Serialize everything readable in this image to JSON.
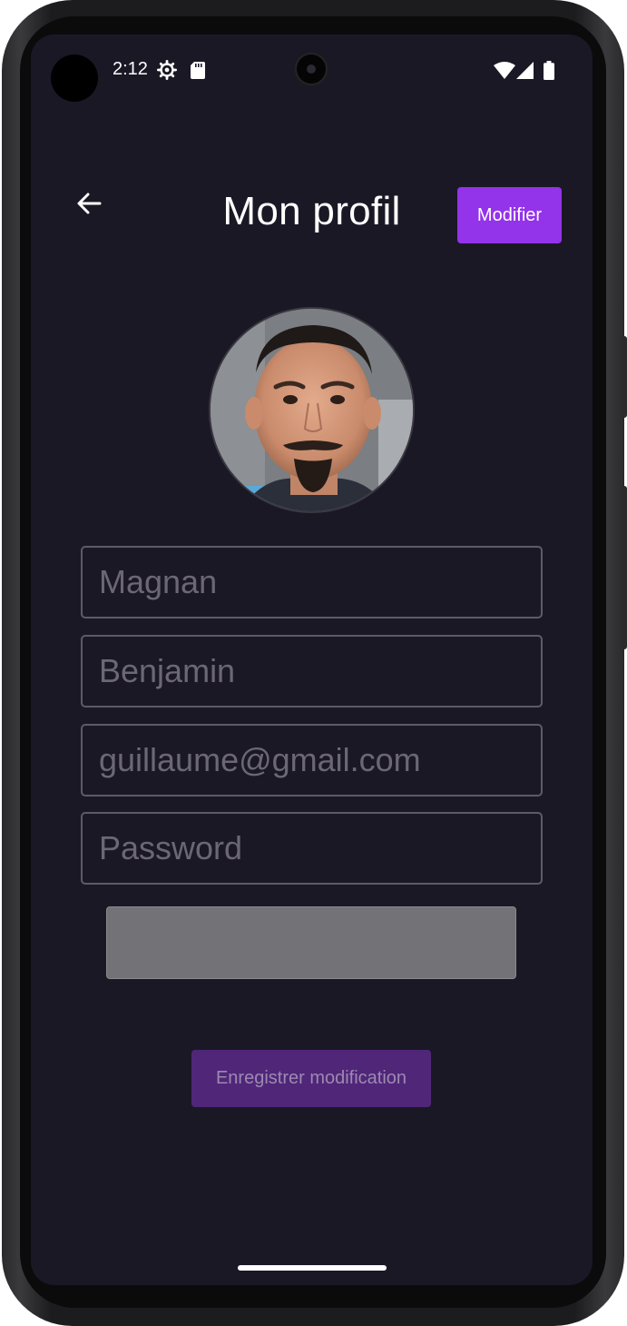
{
  "status_bar": {
    "time": "2:12",
    "icons": [
      "settings-gear-icon",
      "sd-card-icon",
      "wifi-icon",
      "signal-icon",
      "battery-icon"
    ]
  },
  "header": {
    "title": "Mon profil",
    "edit_label": "Modifier",
    "back_icon": "arrow-left-icon"
  },
  "profile": {
    "avatar": "profile-photo"
  },
  "form": {
    "last_name": "Magnan",
    "first_name": "Benjamin",
    "email": "guillaume@gmail.com",
    "password_placeholder": "Password"
  },
  "actions": {
    "save_label": "Enregistrer modification"
  },
  "colors": {
    "background": "#1b1826",
    "accent": "#9333ea",
    "accent_disabled": "#502679",
    "field_border": "#5e5b66",
    "field_text": "#6b6873"
  }
}
